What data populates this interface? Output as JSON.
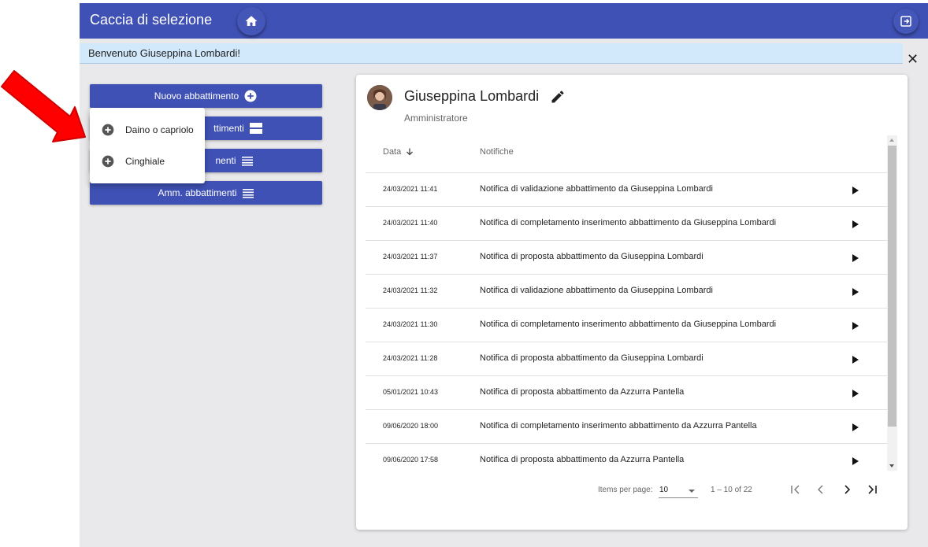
{
  "app": {
    "title": "Caccia di selezione",
    "accent": "#3f51b5"
  },
  "header": {
    "home_icon": "home-icon",
    "logout_icon": "logout-icon"
  },
  "welcome": {
    "text": "Benvenuto Giuseppina Lombardi!",
    "close": "✕"
  },
  "menu": {
    "buttons": [
      {
        "label": "Nuovo abbattimento",
        "icon": "add-circle-icon"
      },
      {
        "label": "ttimenti",
        "icon": "view-agenda-icon"
      },
      {
        "label": "nenti",
        "icon": "list-icon"
      },
      {
        "label": "Amm. abbattimenti",
        "icon": "list-icon"
      }
    ],
    "dropdown": [
      {
        "label": "Daino o capriolo",
        "icon": "add-circle-icon"
      },
      {
        "label": "Cinghiale",
        "icon": "add-circle-icon"
      }
    ]
  },
  "profile": {
    "name": "Giuseppina Lombardi",
    "role": "Amministratore",
    "edit_icon": "pencil-icon"
  },
  "table": {
    "columns": {
      "date": "Data",
      "notifications": "Notifiche"
    },
    "rows": [
      {
        "date": "24/03/2021 11:41",
        "text": "Notifica di validazione abbattimento da Giuseppina Lombardi"
      },
      {
        "date": "24/03/2021 11:40",
        "text": "Notifica di completamento inserimento abbattimento da Giuseppina Lombardi"
      },
      {
        "date": "24/03/2021 11:37",
        "text": "Notifica di proposta abbattimento da Giuseppina Lombardi"
      },
      {
        "date": "24/03/2021 11:32",
        "text": "Notifica di validazione abbattimento da Giuseppina Lombardi"
      },
      {
        "date": "24/03/2021 11:30",
        "text": "Notifica di completamento inserimento abbattimento da Giuseppina Lombardi"
      },
      {
        "date": "24/03/2021 11:28",
        "text": "Notifica di proposta abbattimento da Giuseppina Lombardi"
      },
      {
        "date": "05/01/2021 10:43",
        "text": "Notifica di proposta abbattimento da Azzurra Pantella"
      },
      {
        "date": "09/06/2020 18:00",
        "text": "Notifica di completamento inserimento abbattimento da Azzurra Pantella"
      },
      {
        "date": "09/06/2020 17:58",
        "text": "Notifica di proposta abbattimento da Azzurra Pantella"
      }
    ]
  },
  "pager": {
    "items_label": "Items per page:",
    "page_size": "10",
    "range": "1 – 10 of 22",
    "first": "|<",
    "prev": "<",
    "next": ">",
    "last": ">|"
  }
}
